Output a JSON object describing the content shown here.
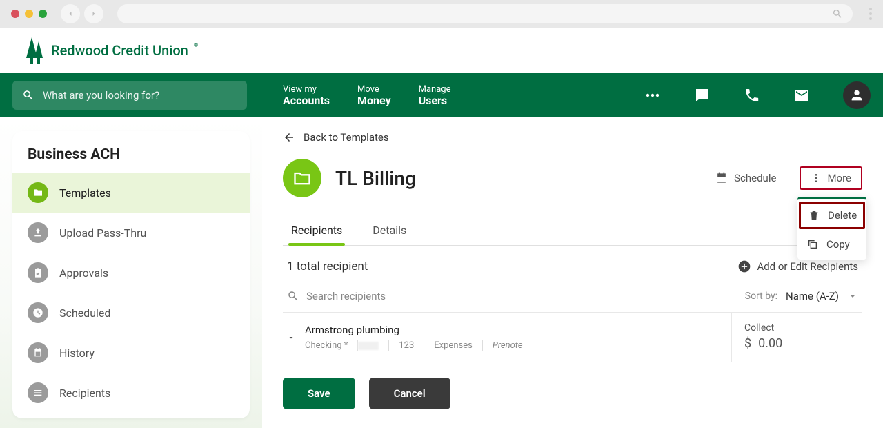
{
  "brand": {
    "name": "Redwood Credit Union"
  },
  "browser": {
    "search_placeholder": ""
  },
  "nav": {
    "search_placeholder": "What are you looking for?",
    "items": [
      {
        "top": "View my",
        "bottom": "Accounts"
      },
      {
        "top": "Move",
        "bottom": "Money"
      },
      {
        "top": "Manage",
        "bottom": "Users"
      }
    ]
  },
  "sidebar": {
    "title": "Business ACH",
    "items": [
      {
        "label": "Templates",
        "active": true
      },
      {
        "label": "Upload Pass-Thru"
      },
      {
        "label": "Approvals"
      },
      {
        "label": "Scheduled"
      },
      {
        "label": "History"
      },
      {
        "label": "Recipients"
      }
    ]
  },
  "content": {
    "back_label": "Back to Templates",
    "template_title": "TL Billing",
    "schedule_label": "Schedule",
    "more_label": "More",
    "dropdown": {
      "delete": "Delete",
      "copy": "Copy"
    },
    "tabs": {
      "recipients": "Recipients",
      "details": "Details"
    },
    "recipient_count": "1 total recipient",
    "add_recipients_label": "Add or Edit Recipients",
    "search_recipients_placeholder": "Search recipients",
    "sort_label": "Sort by:",
    "sort_value": "Name (A-Z)",
    "recipient": {
      "name": "Armstrong plumbing",
      "account": "Checking *",
      "code": "123",
      "category": "Expenses",
      "status": "Prenote",
      "collect_label": "Collect",
      "collect_currency": "$",
      "collect_amount": "0.00"
    },
    "buttons": {
      "save": "Save",
      "cancel": "Cancel"
    }
  }
}
